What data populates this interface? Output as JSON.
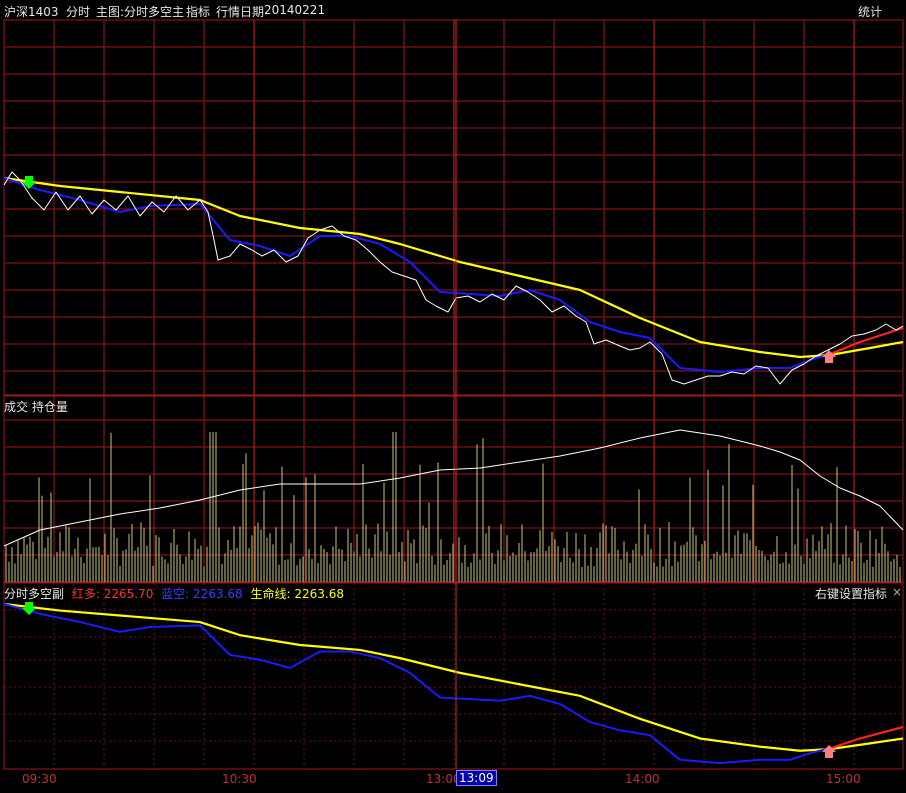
{
  "header": {
    "symbol": "沪深1403",
    "mode": "分时",
    "main_chart": "主图:分时多空主",
    "indicator_label": "指标",
    "date_label": "行情日期",
    "date_value": "20140221",
    "stats_button": "统计"
  },
  "volume_panel": {
    "label": "成交 持仓量"
  },
  "sub_panel": {
    "name": "分时多空副",
    "red_label": "红多:",
    "red_value": "2265.70",
    "blue_label": "蓝空:",
    "blue_value": "2263.68",
    "life_label": "生命线:",
    "life_value": "2263.68",
    "settings_hint": "右键设置指标",
    "close_glyph": "×"
  },
  "time_axis": {
    "ticks": [
      "09:30",
      "10:30",
      "13:00",
      "14:00",
      "15:00"
    ],
    "cursor_time": "13:09"
  },
  "colors": {
    "background": "#000000",
    "grid": "#a01818",
    "price_line": "#ffffff",
    "blue_line": "#1a1aff",
    "yellow_line": "#ffff00",
    "red_line": "#ff2020",
    "volume_bars": "#c8c878",
    "buy_arrow": "#00ff00",
    "sell_arrow": "#ff8080",
    "cursor_box": "#0000aa"
  },
  "chart_data": {
    "type": "line",
    "description_series": [
      {
        "name": "红多",
        "color": "#ff2020"
      },
      {
        "name": "蓝空",
        "color": "#1a1aff"
      },
      {
        "name": "生命线",
        "color": "#ffff00"
      }
    ]
  }
}
